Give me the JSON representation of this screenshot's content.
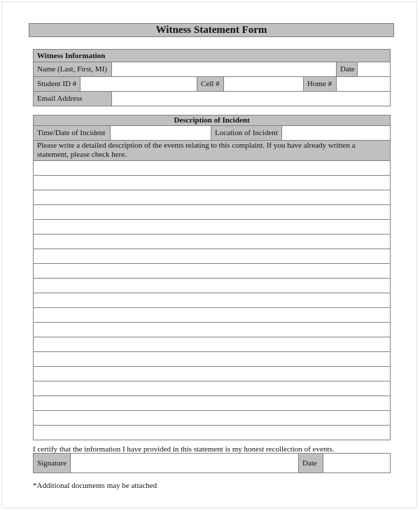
{
  "form": {
    "title": "Witness Statement Form"
  },
  "witness_info": {
    "header": "Witness Information",
    "name_label": "Name (Last, First, MI)",
    "name_value": "",
    "date_label": "Date",
    "date_value": "",
    "student_id_label": "Student ID #",
    "student_id_value": "",
    "cell_label": "Cell #",
    "cell_value": "",
    "home_label": "Home #",
    "home_value": "",
    "email_label": "Email Address",
    "email_value": ""
  },
  "incident": {
    "header": "Description of Incident",
    "time_date_label": "Time/Date of Incident",
    "time_date_value": "",
    "location_label": "Location of Incident",
    "location_value": "",
    "instructions": "Please write a detailed description of the events relating to this complaint. If you have already written a statement, please check here.",
    "blank_line_count": 19
  },
  "certification": {
    "statement": "I certify that the information I have provided in this statement is my honest recollection of events.",
    "signature_label": "Signature",
    "signature_value": "",
    "date_label": "Date",
    "date_value": ""
  },
  "footnote": "*Additional documents may be attached"
}
